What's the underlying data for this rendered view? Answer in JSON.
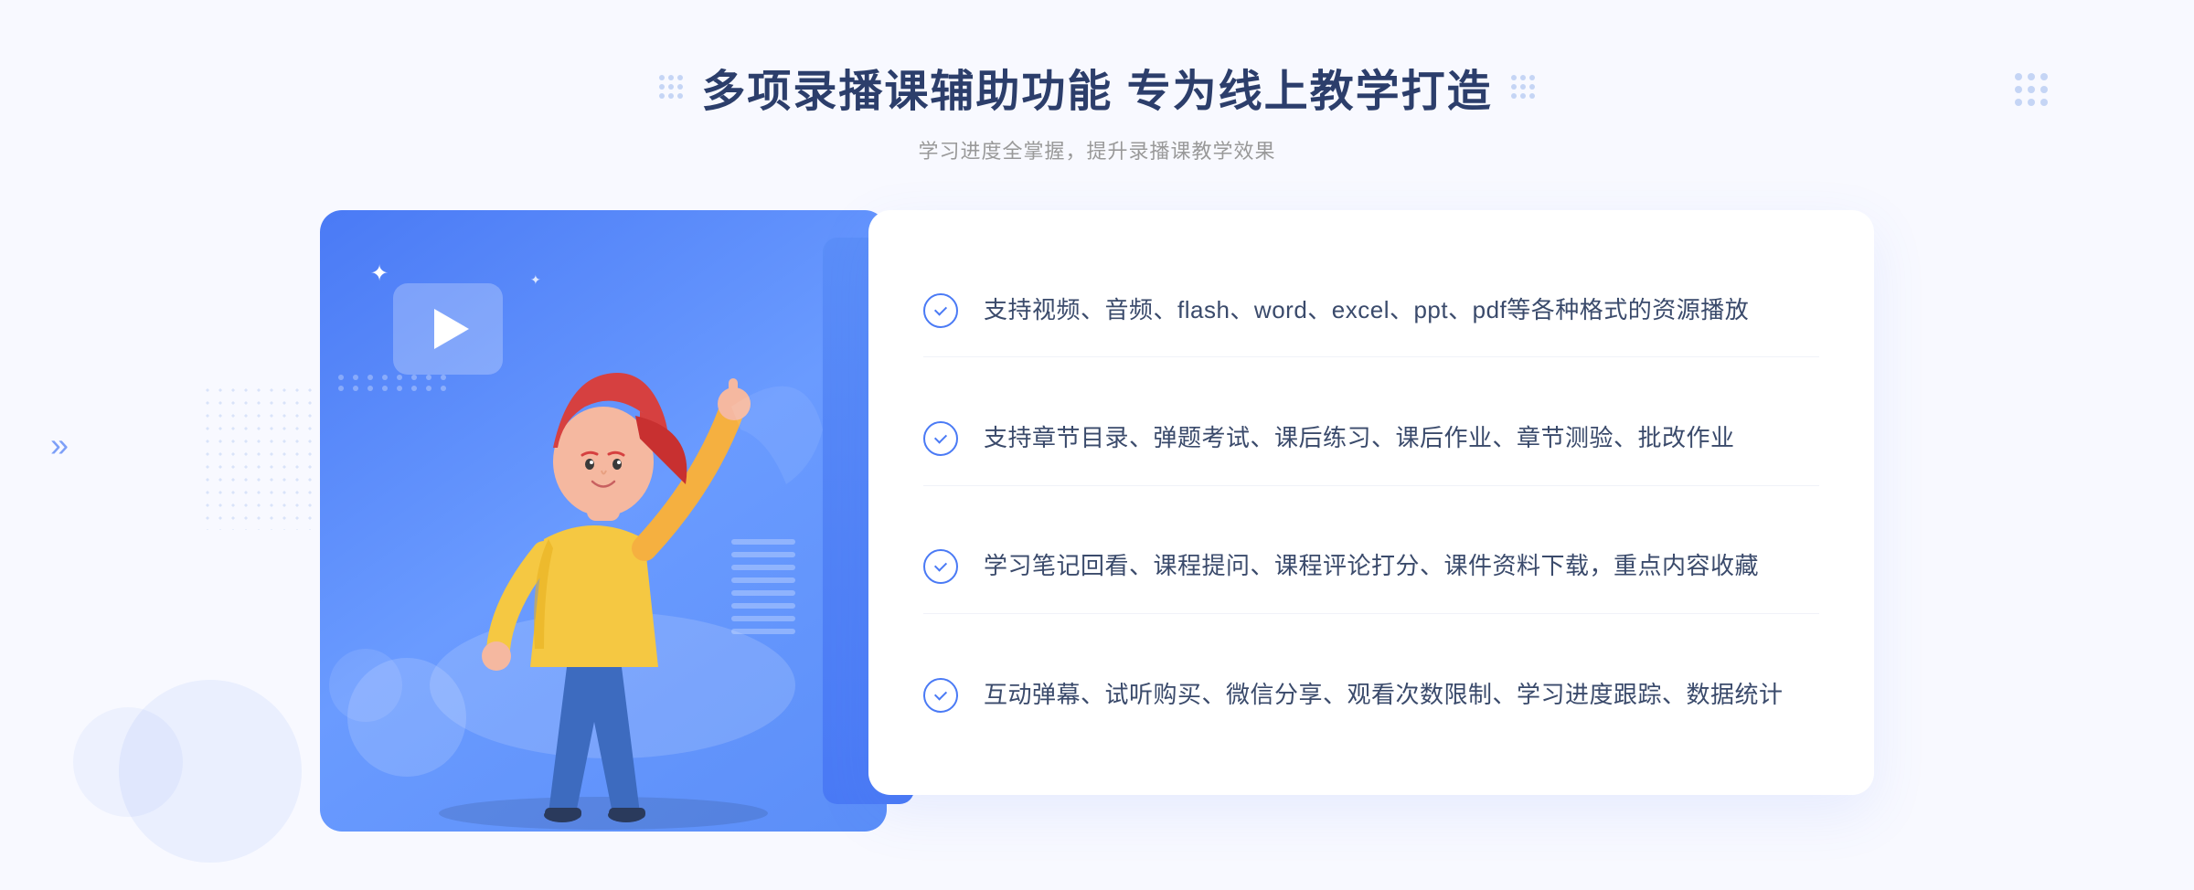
{
  "header": {
    "title": "多项录播课辅助功能 专为线上教学打造",
    "subtitle": "学习进度全掌握，提升录播课教学效果"
  },
  "features": [
    {
      "id": 1,
      "text": "支持视频、音频、flash、word、excel、ppt、pdf等各种格式的资源播放"
    },
    {
      "id": 2,
      "text": "支持章节目录、弹题考试、课后练习、课后作业、章节测验、批改作业"
    },
    {
      "id": 3,
      "text": "学习笔记回看、课程提问、课程评论打分、课件资料下载，重点内容收藏"
    },
    {
      "id": 4,
      "text": "互动弹幕、试听购买、微信分享、观看次数限制、学习进度跟踪、数据统计"
    }
  ],
  "icons": {
    "check": "✓",
    "play": "▶",
    "chevron": "》",
    "stars": "✦"
  },
  "colors": {
    "primary": "#4a7af5",
    "title": "#2c3e6b",
    "text": "#3a4a6b",
    "subtitle": "#999999",
    "background": "#f8f9ff"
  }
}
